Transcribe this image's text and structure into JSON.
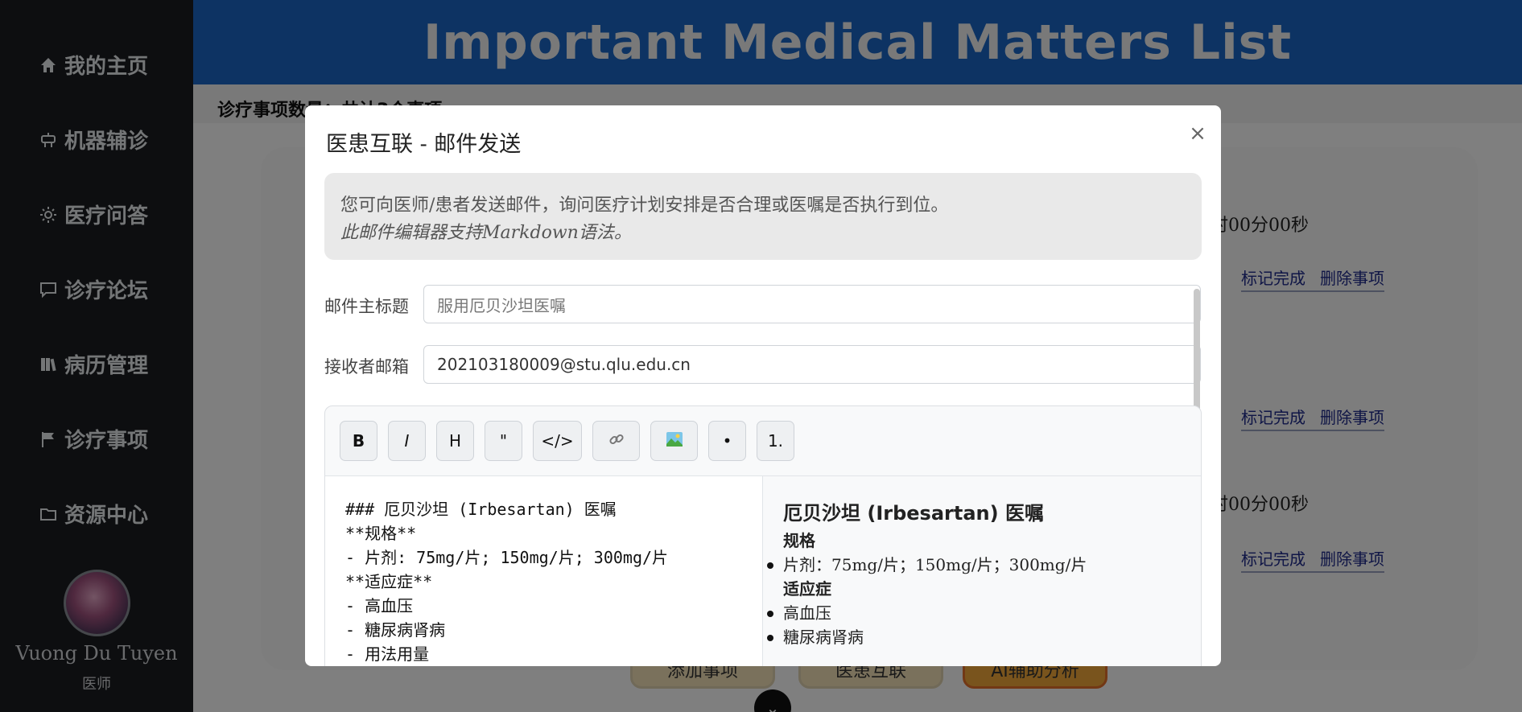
{
  "sidebar": {
    "items": [
      {
        "label": "我的主页",
        "icon": "home-icon"
      },
      {
        "label": "机器辅诊",
        "icon": "robot-icon"
      },
      {
        "label": "医疗问答",
        "icon": "sun-icon"
      },
      {
        "label": "诊疗论坛",
        "icon": "chat-icon"
      },
      {
        "label": "病历管理",
        "icon": "records-icon"
      },
      {
        "label": "诊疗事项",
        "icon": "flag-icon"
      },
      {
        "label": "资源中心",
        "icon": "folder-icon"
      }
    ],
    "profile": {
      "name": "Vuong Du Tuyen",
      "role": "医师"
    }
  },
  "main": {
    "banner_title": "Important Medical Matters List",
    "subbar_text": "诊疗事项数量：共计3个事项",
    "rows": [
      {
        "time_fragment": "时00分00秒",
        "mark_done": "标记完成",
        "delete": "删除事项"
      },
      {
        "time_fragment": "",
        "mark_done": "标记完成",
        "delete": "删除事项"
      },
      {
        "time_fragment": "时00分00秒",
        "mark_done": "标记完成",
        "delete": "删除事项"
      }
    ],
    "bottom_buttons": {
      "add": "添加事项",
      "connect": "医患互联",
      "ai": "AI辅助分析"
    }
  },
  "modal": {
    "title": "医患互联 - 邮件发送",
    "close_label": "×",
    "info_line1": "您可向医师/患者发送邮件，询问医疗计划安排是否合理或医嘱是否执行到位。",
    "info_line2": "此邮件编辑器支持Markdown语法。",
    "subject_label": "邮件主标题",
    "subject_placeholder": "服用厄贝沙坦医嘱",
    "recipient_label": "接收者邮箱",
    "recipient_value": "202103180009@stu.qlu.edu.cn",
    "toolbar": {
      "bold": "B",
      "italic": "I",
      "heading": "H",
      "quote": "\"",
      "code": "</>",
      "link_icon": "link-icon",
      "image_icon": "image-icon",
      "bullet": "•",
      "ordered": "1."
    },
    "editor_source": "### 厄贝沙坦 (Irbesartan) 医嘱\n**规格**\n- 片剂: 75mg/片; 150mg/片; 300mg/片\n**适应症**\n- 高血压\n- 糖尿病肾病\n- 用法用量",
    "preview": {
      "heading": "厄贝沙坦 (Irbesartan) 医嘱",
      "spec_label": "规格",
      "spec_item": "片剂：75mg/片；150mg/片；300mg/片",
      "indication_label": "适应症",
      "indications": [
        "高血压",
        "糖尿病肾病"
      ]
    }
  }
}
